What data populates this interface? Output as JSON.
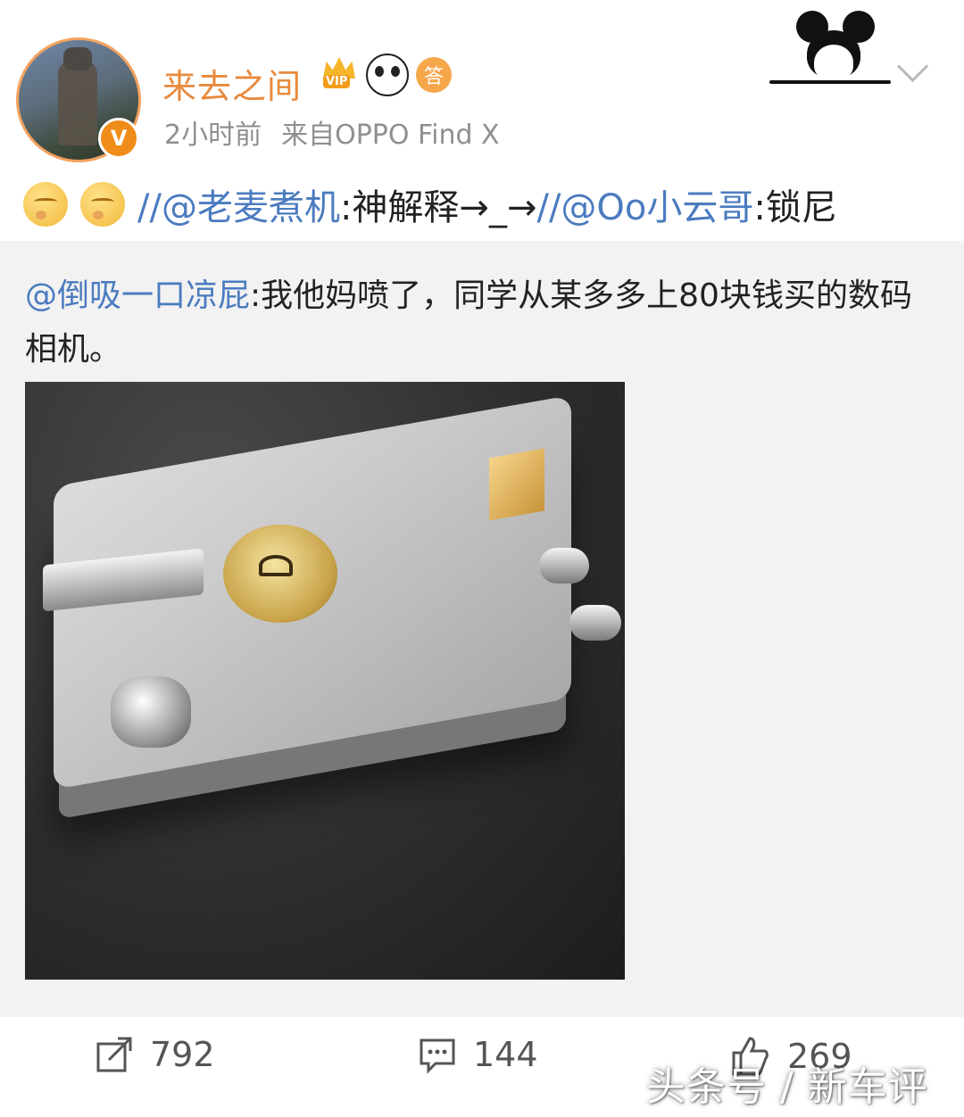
{
  "post": {
    "username": "来去之间",
    "badges": {
      "vip_label": "VIP",
      "answer_label": "答"
    },
    "verified_label": "V",
    "time": "2小时前",
    "source": "来自OPPO Find X"
  },
  "repost": {
    "mention1": "//@老麦煮机",
    "text1": ":神解释→_→",
    "mention2": "//@Oo小云哥",
    "text2": ":锁尼"
  },
  "original": {
    "author": "@倒吸一口凉屁",
    "text": ":我他妈喷了，同学从某多多上80块钱买的数码相机。"
  },
  "toolbar": {
    "share_count": "792",
    "comment_count": "144",
    "like_count": "269"
  },
  "watermark": "头条号 / 新车评",
  "colors": {
    "username": "#e8893c",
    "mention": "#4b7bbf",
    "meta": "#8f8f8f",
    "orig_bg": "#f2f2f2"
  }
}
